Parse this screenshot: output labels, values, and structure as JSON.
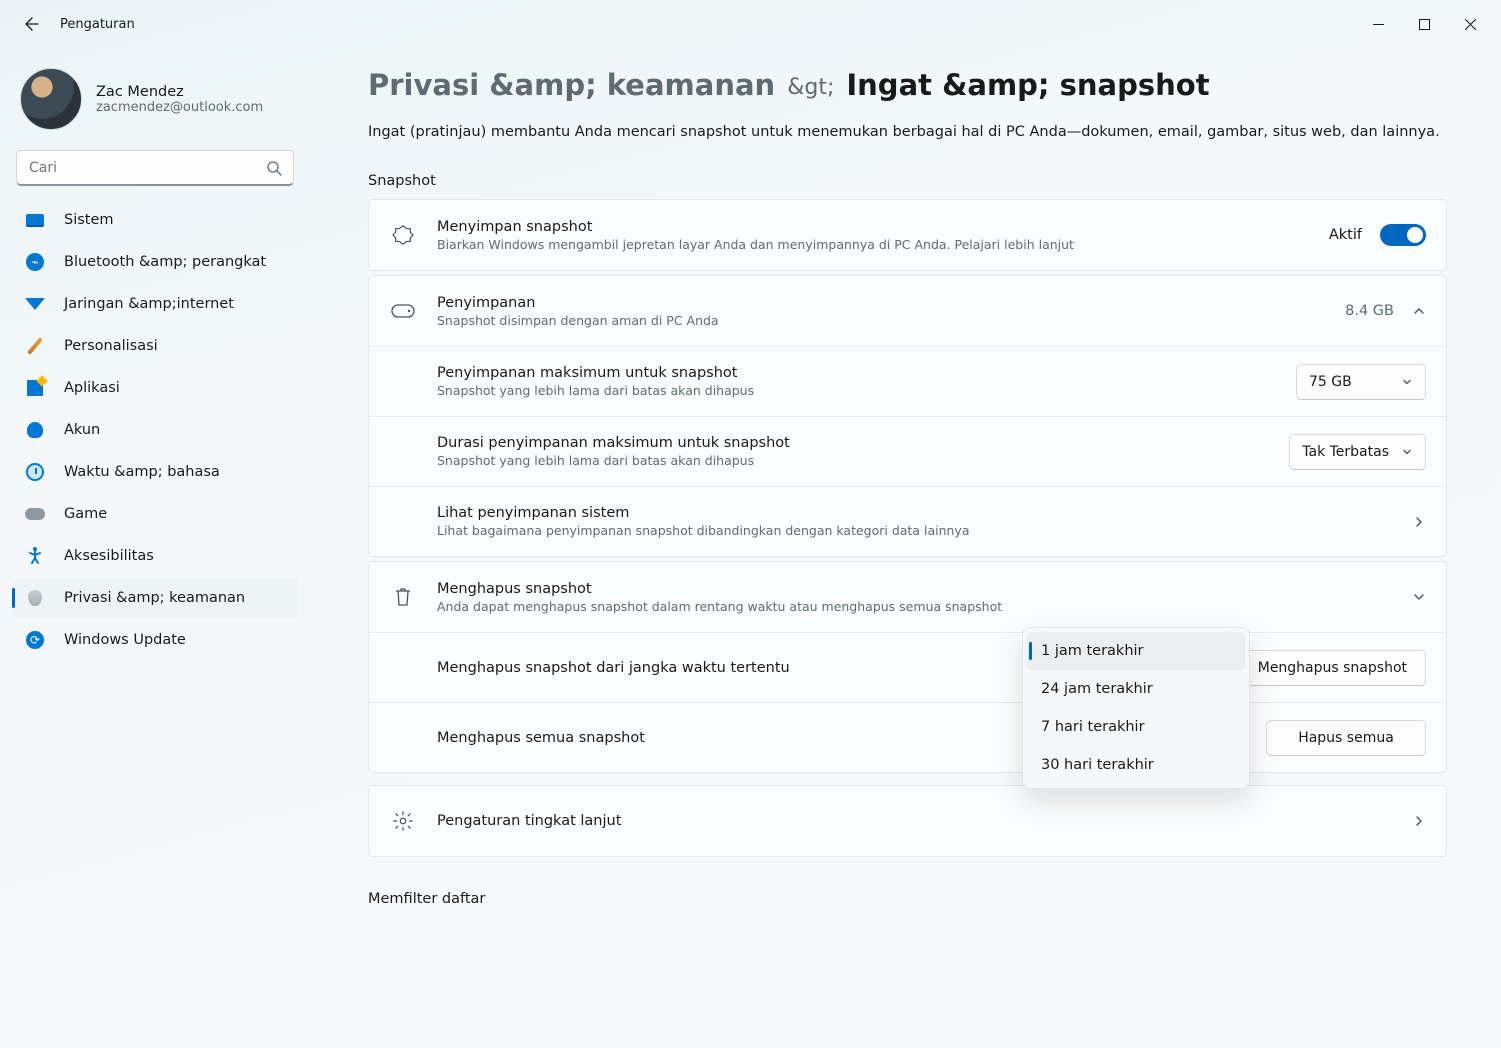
{
  "window": {
    "title": "Pengaturan"
  },
  "user": {
    "name": "Zac Mendez",
    "email": "zacmendez@outlook.com"
  },
  "search": {
    "placeholder": "Cari"
  },
  "sidebar": {
    "items": [
      {
        "label": "Sistem"
      },
      {
        "label": "Bluetooth &amp; perangkat"
      },
      {
        "label": "Jaringan &amp;internet"
      },
      {
        "label": "Personalisasi"
      },
      {
        "label": "Aplikasi"
      },
      {
        "label": "Akun"
      },
      {
        "label": "Waktu &amp; bahasa"
      },
      {
        "label": "Game"
      },
      {
        "label": "Aksesibilitas"
      },
      {
        "label": "Privasi &amp; keamanan"
      },
      {
        "label": "Windows Update"
      }
    ]
  },
  "breadcrumb": {
    "parent": "Privasi &amp; keamanan",
    "sep": "&gt;",
    "page": "Ingat &amp; snapshot"
  },
  "lead": "Ingat (pratinjau) membantu Anda mencari snapshot untuk menemukan berbagai hal di PC Anda—dokumen, email, gambar, situs web, dan lainnya.",
  "sections": {
    "snapshot": "Snapshot",
    "filter": "Memfilter daftar"
  },
  "save": {
    "title": "Menyimpan snapshot",
    "desc": "Biarkan Windows mengambil jepretan layar Anda dan menyimpannya di PC Anda. Pelajari lebih lanjut",
    "toggle_label": "Aktif"
  },
  "storage": {
    "title": "Penyimpanan",
    "desc": "Snapshot disimpan dengan aman di PC Anda",
    "used": "8.4 GB",
    "max_title": "Penyimpanan maksimum untuk snapshot",
    "max_desc": "Snapshot yang lebih lama dari batas akan dihapus",
    "max_value": "75 GB",
    "dur_title": "Durasi penyimpanan maksimum untuk snapshot",
    "dur_desc": "Snapshot yang lebih lama dari batas akan dihapus",
    "dur_value": "Tak Terbatas",
    "view_title": "Lihat penyimpanan sistem",
    "view_desc": "Lihat bagaimana penyimpanan snapshot dibandingkan dengan kategori data lainnya"
  },
  "delete": {
    "title": "Menghapus snapshot",
    "desc": "Anda dapat menghapus snapshot dalam rentang waktu atau menghapus semua snapshot",
    "range_title": "Menghapus snapshot dari jangka waktu tertentu",
    "range_button": "Menghapus snapshot",
    "all_title": "Menghapus semua snapshot",
    "all_button": "Hapus semua"
  },
  "dropdown": {
    "options": [
      {
        "label": "1 jam terakhir"
      },
      {
        "label": "24 jam terakhir"
      },
      {
        "label": "7 hari terakhir"
      },
      {
        "label": "30 hari terakhir"
      }
    ]
  },
  "advanced": {
    "title": "Pengaturan tingkat lanjut"
  }
}
